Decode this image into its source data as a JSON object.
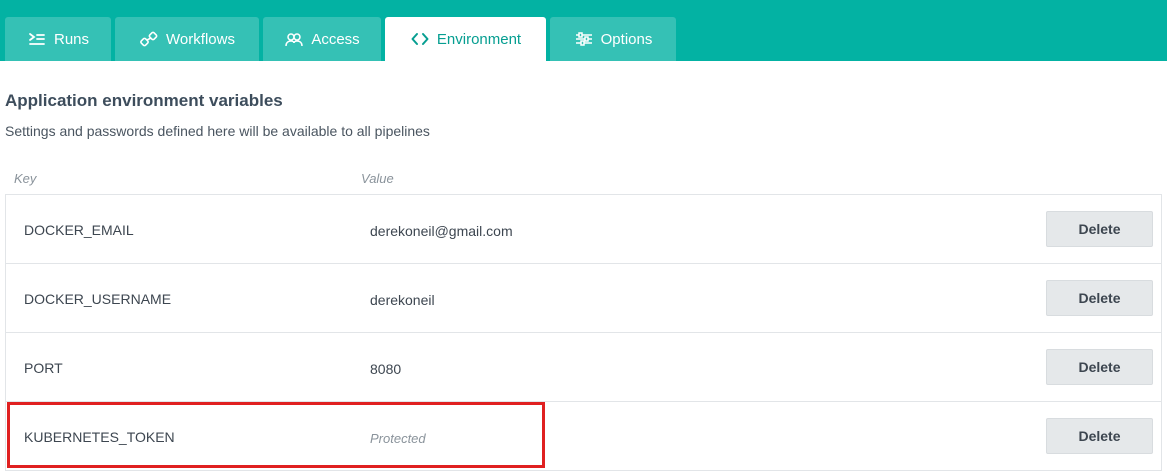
{
  "tabs": [
    {
      "label": "Runs",
      "icon": "runs-icon",
      "active": false
    },
    {
      "label": "Workflows",
      "icon": "workflows-icon",
      "active": false
    },
    {
      "label": "Access",
      "icon": "access-icon",
      "active": false
    },
    {
      "label": "Environment",
      "icon": "code-icon",
      "active": true
    },
    {
      "label": "Options",
      "icon": "options-icon",
      "active": false
    }
  ],
  "page": {
    "title": "Application environment variables",
    "subtitle": "Settings and passwords defined here will be available to all pipelines"
  },
  "table": {
    "headers": {
      "key": "Key",
      "value": "Value"
    },
    "rows": [
      {
        "key": "DOCKER_EMAIL",
        "value": "derekoneil@gmail.com",
        "protected": false,
        "action": "Delete"
      },
      {
        "key": "DOCKER_USERNAME",
        "value": "derekoneil",
        "protected": false,
        "action": "Delete"
      },
      {
        "key": "PORT",
        "value": "8080",
        "protected": false,
        "action": "Delete"
      },
      {
        "key": "KUBERNETES_TOKEN",
        "value": "Protected",
        "protected": true,
        "action": "Delete"
      }
    ]
  },
  "colors": {
    "tabbar": "#03b2a3",
    "tab_inactive": "#35c1b5",
    "tab_active_text": "#069e91",
    "highlight": "#e02020"
  }
}
